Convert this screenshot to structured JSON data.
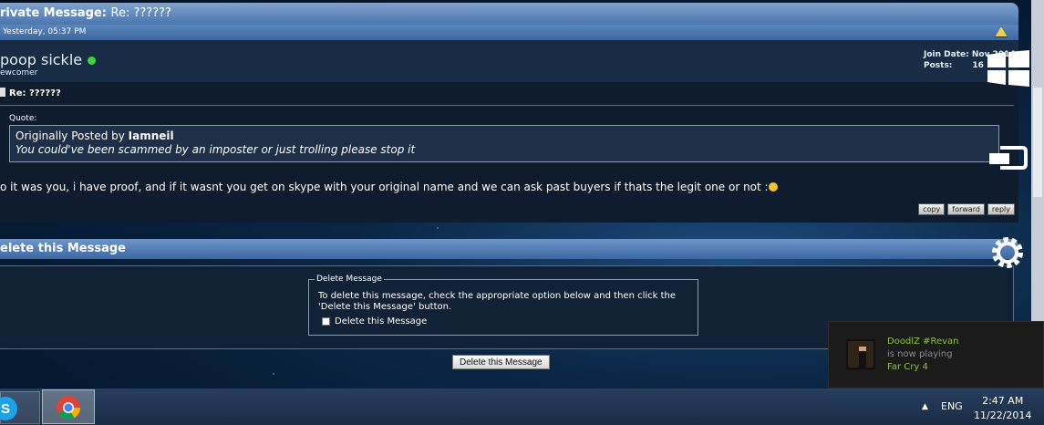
{
  "post": {
    "title_prefix": "rivate Message:",
    "title_subject": "Re: ??????",
    "date": "Yesterday, 05:37 PM",
    "username": "poop sickle",
    "user_title": "ewcomer",
    "join_info": "Join Date: Nov 2014\nPosts:       16",
    "subject": "Re: ??????",
    "quote_label": "Quote:",
    "quote_prefix": "Originally Posted by ",
    "quote_author": "Iamneil",
    "quote_text": "You could've been scammed by an imposter or just trolling please stop it",
    "message": "o it was you, i have proof, and if it wasnt you get on skype with your original name and we can ask past buyers if thats the legit one or not :",
    "buttons": {
      "copy": "copy",
      "forward": "forward",
      "reply": "reply"
    }
  },
  "delete_section": {
    "header": "elete this Message",
    "legend": "Delete Message",
    "instruction": "To delete this message, check the appropriate option below and then click the 'Delete this Message' button.",
    "checkbox_label": "Delete this Message",
    "checkbox_checked": false,
    "button_label": "Delete this Message"
  },
  "notification": {
    "name": "DoodlZ #Revan",
    "status": "is now playing",
    "game": "Far Cry 4"
  },
  "taskbar": {
    "language": "ENG",
    "time": "2:47 AM",
    "date": "11/22/2014"
  },
  "icons": {
    "warning": "warning-icon",
    "windows": "windows-logo-icon",
    "devices": "devices-icon",
    "settings": "gear-icon",
    "skype": "skype-icon",
    "chrome": "chrome-icon"
  },
  "colors": {
    "header_blue": "#4a76ad",
    "panel_dark": "#0e1c2e",
    "online_green": "#3fd43a",
    "steam_green": "#8cc23c"
  }
}
